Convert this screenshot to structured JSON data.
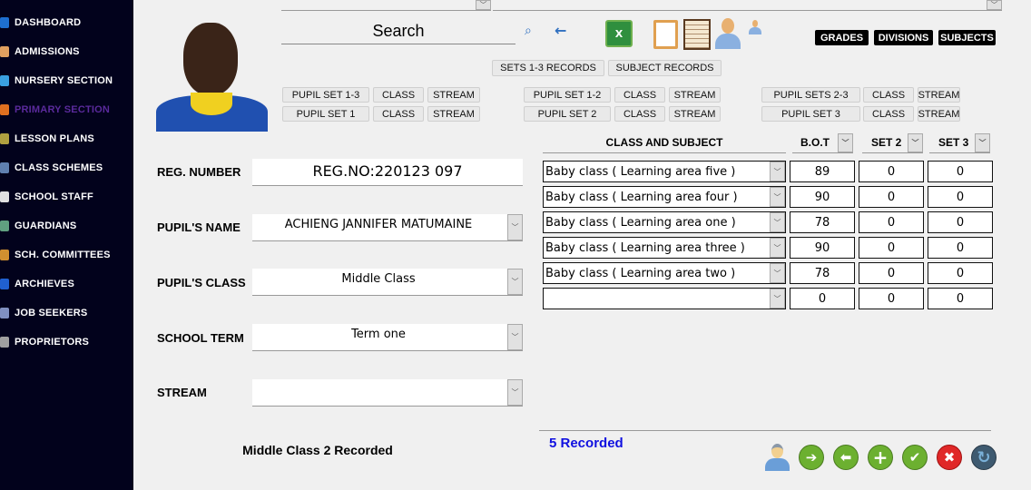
{
  "sidebar": {
    "items": [
      {
        "label": "DASHBOARD",
        "color": "#1e6fd0"
      },
      {
        "label": "ADMISSIONS",
        "color": "#e0a060"
      },
      {
        "label": "NURSERY SECTION",
        "color": "#3aa0e0"
      },
      {
        "label": "PRIMARY SECTION",
        "color": "#e07020"
      },
      {
        "label": "LESSON PLANS",
        "color": "#b0a040"
      },
      {
        "label": "CLASS SCHEMES",
        "color": "#6080b0"
      },
      {
        "label": "SCHOOL STAFF",
        "color": "#e0e0e0"
      },
      {
        "label": "GUARDIANS",
        "color": "#60a080"
      },
      {
        "label": "SCH. COMMITTEES",
        "color": "#d09030"
      },
      {
        "label": "ARCHIEVES",
        "color": "#2060d0"
      },
      {
        "label": "JOB SEEKERS",
        "color": "#8090c0"
      },
      {
        "label": "PROPRIETORS",
        "color": "#a0a0a0"
      }
    ],
    "active": 3
  },
  "toolbar": {
    "search_label": "Search",
    "grades": "GRADES",
    "divisions": "DIVISIONS",
    "subjects": "SUBJECTS",
    "sets_records": "SETS 1-3 RECORDS",
    "subject_records": "SUBJECT RECORDS"
  },
  "groups": [
    [
      {
        "label": "PUPIL  SET 1-3"
      },
      {
        "label": "CLASS"
      },
      {
        "label": "STREAM"
      },
      {
        "label": "PUPIL  SET 1"
      },
      {
        "label": "CLASS"
      },
      {
        "label": "STREAM"
      }
    ],
    [
      {
        "label": "PUPIL  SET 1-2"
      },
      {
        "label": "CLASS"
      },
      {
        "label": "STREAM"
      },
      {
        "label": "PUPIL  SET 2"
      },
      {
        "label": "CLASS"
      },
      {
        "label": "STREAM"
      }
    ],
    [
      {
        "label": "PUPIL  SETS 2-3"
      },
      {
        "label": "CLASS"
      },
      {
        "label": "STREAM"
      },
      {
        "label": "PUPIL SET 3"
      },
      {
        "label": "CLASS"
      },
      {
        "label": "STREAM"
      }
    ]
  ],
  "form": {
    "reg_label": "REG. NUMBER",
    "reg_value": "REG.NO:220123 097",
    "name_label": "PUPIL'S NAME",
    "name_value": "ACHIENG JANNIFER MATUMAINE",
    "class_label": "PUPIL'S CLASS",
    "class_value": "Middle Class",
    "term_label": "SCHOOL TERM",
    "term_value": "Term one",
    "stream_label": "STREAM",
    "stream_value": "",
    "recorded": "Middle Class 2 Recorded"
  },
  "table": {
    "headers": {
      "subject": "CLASS AND SUBJECT",
      "bot": "B.O.T",
      "set2": "SET 2",
      "set3": "SET 3"
    },
    "rows": [
      {
        "subject": "Baby class ( Learning area five )",
        "bot": "89",
        "set2": "0",
        "set3": "0"
      },
      {
        "subject": "Baby class ( Learning area four )",
        "bot": "90",
        "set2": "0",
        "set3": "0"
      },
      {
        "subject": "Baby class ( Learning area one )",
        "bot": "78",
        "set2": "0",
        "set3": "0"
      },
      {
        "subject": "Baby class ( Learning area three )",
        "bot": "90",
        "set2": "0",
        "set3": "0"
      },
      {
        "subject": "Baby class ( Learning area two )",
        "bot": "78",
        "set2": "0",
        "set3": "0"
      },
      {
        "subject": "",
        "bot": "0",
        "set2": "0",
        "set3": "0"
      }
    ],
    "recorded": "5 Recorded"
  }
}
